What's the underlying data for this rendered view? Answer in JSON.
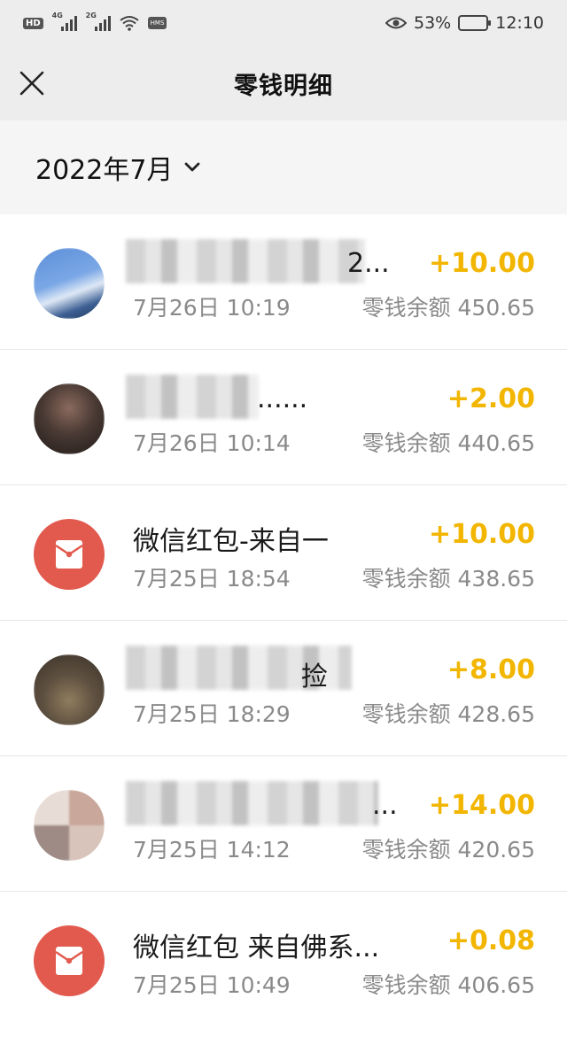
{
  "status_bar": {
    "left_badge": "HD",
    "sig1_tag": "4G",
    "sig2_tag": "2G",
    "hms": "HMS",
    "battery_pct": "53%",
    "battery_level": 0.53,
    "time": "12:10"
  },
  "header": {
    "title": "零钱明细"
  },
  "month": {
    "label": "2022年7月"
  },
  "rows": [
    {
      "title": "2...",
      "time": "7月26日 10:19",
      "amount": "+10.00",
      "balance": "零钱余额 450.65",
      "avatar": "blurred-photo"
    },
    {
      "title": "......",
      "time": "7月26日 10:14",
      "amount": "+2.00",
      "balance": "零钱余额 440.65",
      "avatar": "blurred-photo"
    },
    {
      "title": "微信红包-来自一",
      "time": "7月25日 18:54",
      "amount": "+10.00",
      "balance": "零钱余额 438.65",
      "avatar": "red-envelope-icon"
    },
    {
      "title": "捡",
      "time": "7月25日 18:29",
      "amount": "+8.00",
      "balance": "零钱余额 428.65",
      "avatar": "blurred-photo"
    },
    {
      "title": "...",
      "time": "7月25日 14:12",
      "amount": "+14.00",
      "balance": "零钱余额 420.65",
      "avatar": "blurred-photo"
    },
    {
      "title": "微信红包 来自佛系...",
      "time": "7月25日 10:49",
      "amount": "+0.08",
      "balance": "零钱余额 406.65",
      "avatar": "red-envelope-icon"
    }
  ],
  "colors": {
    "amount": "#f2b601",
    "red_packet": "#e25a4e",
    "background": "#ededed"
  }
}
